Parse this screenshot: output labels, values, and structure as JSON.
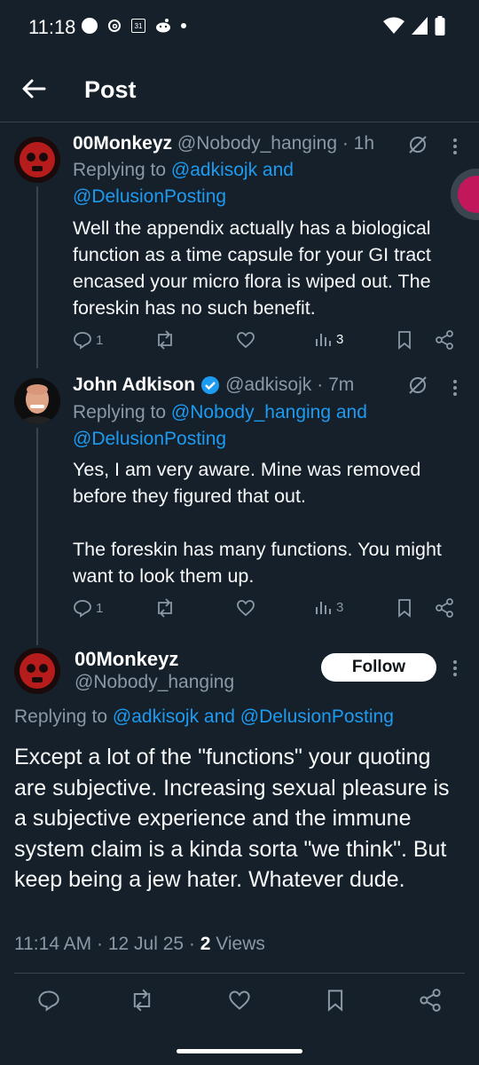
{
  "status_bar": {
    "time": "11:18",
    "calendar_day": "31"
  },
  "header": {
    "title": "Post"
  },
  "tweets": [
    {
      "name": "00Monkeyz",
      "handle": "@Nobody_hanging",
      "time": "· 1h",
      "replying_prefix": "Replying to ",
      "replying_to": "@adkisojk and @DelusionPosting",
      "text": "Well the appendix actually has a biological function as a time capsule for your GI tract encased your micro flora is wiped out. The foreskin has no such benefit.",
      "replies": "1",
      "views": "3"
    },
    {
      "name": "John Adkison",
      "handle": "@adkisojk",
      "time": "· 7m",
      "replying_prefix": "Replying to ",
      "replying_to": "@Nobody_hanging and @DelusionPosting",
      "text": "Yes, I am very aware. Mine was removed before they figured that out.\n\nThe foreskin has many functions. You might want to look them up.",
      "replies": "1",
      "views": "3"
    }
  ],
  "main_post": {
    "name": "00Monkeyz",
    "handle": "@Nobody_hanging",
    "follow_label": "Follow",
    "replying_prefix": "Replying to ",
    "replying_to": "@adkisojk and @DelusionPosting",
    "text": "Except a lot of the \"functions\" your quoting are subjective. Increasing sexual pleasure is a subjective experience and the immune system claim is a kinda sorta \"we think\". But keep being a jew hater. Whatever dude.",
    "timestamp": "11:14 AM · 12 Jul 25 · ",
    "views_count": "2",
    "views_label": " Views"
  },
  "colors": {
    "background": "#15202b",
    "link": "#1d9bf0",
    "muted": "#8b98a5",
    "verified": "#1d9bf0"
  }
}
